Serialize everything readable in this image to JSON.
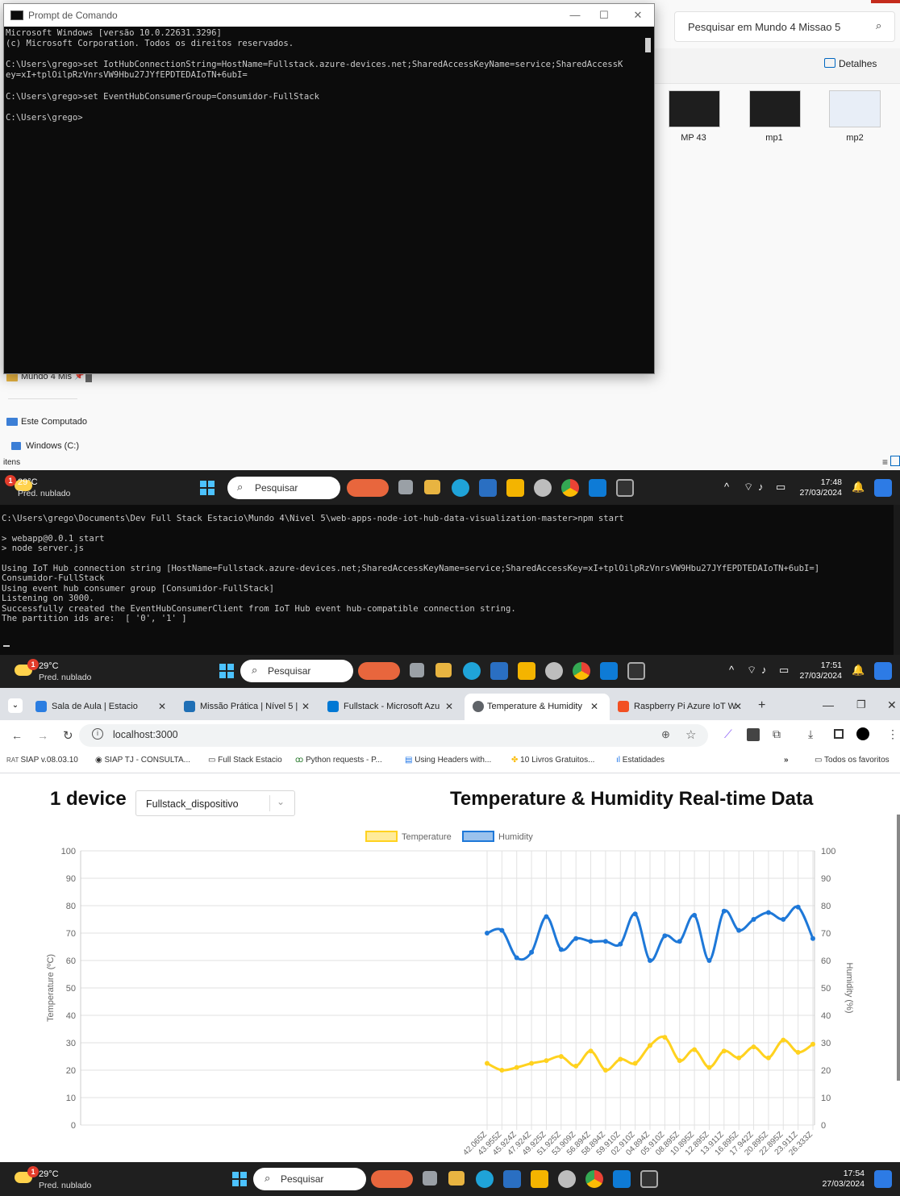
{
  "explorer": {
    "search_placeholder": "Pesquisar em Mundo 4 Missao 5",
    "details_label": "Detalhes",
    "thumbnails": [
      "MP 43",
      "mp1",
      "mp2"
    ],
    "sidebar": {
      "folder_item": "Mundo 4 Mis",
      "pc_item": "Este Computado",
      "drive_item": "Windows (C:)"
    },
    "status": "itens"
  },
  "cmd_window": {
    "title": "Prompt de Comando",
    "lines": [
      "Microsoft Windows [versão 10.0.22631.3296]",
      "(c) Microsoft Corporation. Todos os direitos reservados.",
      "",
      "C:\\Users\\grego>set IotHubConnectionString=HostName=Fullstack.azure-devices.net;SharedAccessKeyName=service;SharedAccessK",
      "ey=xI+tplOilpRzVnrsVW9Hbu27JYfEPDTEDAIoTN+6ubI=",
      "",
      "C:\\Users\\grego>set EventHubConsumerGroup=Consumidor-FullStack",
      "",
      "C:\\Users\\grego>"
    ]
  },
  "taskbar1": {
    "temp": "29°C",
    "condition": "Pred. nublado",
    "search": "Pesquisar",
    "time": "17:48",
    "date": "27/03/2024",
    "badge": "1"
  },
  "terminal2": {
    "lines": [
      "C:\\Users\\grego\\Documents\\Dev Full Stack Estacio\\Mundo 4\\Nivel 5\\web-apps-node-iot-hub-data-visualization-master>npm start",
      "",
      "> webapp@0.0.1 start",
      "> node server.js",
      "",
      "Using IoT Hub connection string [HostName=Fullstack.azure-devices.net;SharedAccessKeyName=service;SharedAccessKey=xI+tplOilpRzVnrsVW9Hbu27JYfEPDTEDAIoTN+6ubI=]",
      "Consumidor-FullStack",
      "Using event hub consumer group [Consumidor-FullStack]",
      "Listening on 3000.",
      "Successfully created the EventHubConsumerClient from IoT Hub event hub-compatible connection string.",
      "The partition ids are:  [ '0', '1' ]"
    ]
  },
  "taskbar2": {
    "temp": "29°C",
    "condition": "Pred. nublado",
    "search": "Pesquisar",
    "time": "17:51",
    "date": "27/03/2024",
    "badge": "1"
  },
  "taskbar3": {
    "temp": "29°C",
    "condition": "Pred. nublado",
    "search": "Pesquisar",
    "time": "17:54",
    "date": "27/03/2024",
    "badge": "1"
  },
  "browser": {
    "tabs": [
      {
        "label": "Sala de Aula | Estacio",
        "color": "#2a7de1"
      },
      {
        "label": "Missão Prática | Nível 5 |",
        "color": "#1f6fb5"
      },
      {
        "label": "Fullstack - Microsoft Azu",
        "color": "#0078d4"
      },
      {
        "label": "Temperature & Humidity",
        "color": "#5f6368"
      },
      {
        "label": "Raspberry Pi Azure IoT W",
        "color": "#f25022"
      }
    ],
    "url": "localhost:3000",
    "bookmarks": [
      "SIAP v.08.03.10",
      "SIAP TJ - CONSULTA...",
      "Full Stack Estacio",
      "Python requests - P...",
      "Using Headers with...",
      "10 Livros Gratuitos...",
      "Estatidades"
    ],
    "all_bookmarks": "Todos os favoritos"
  },
  "page": {
    "device_count": "1 device",
    "device_selected": "Fullstack_dispositivo",
    "title": "Temperature & Humidity Real-time Data"
  },
  "chart_data": {
    "type": "line",
    "legend": [
      "Temperature",
      "Humidity"
    ],
    "ylabel_left": "Temperature (ºC)",
    "ylabel_right": "Humidity (%)",
    "ylim": [
      0,
      100
    ],
    "y_ticks": [
      0,
      10,
      20,
      30,
      40,
      50,
      60,
      70,
      80,
      90,
      100
    ],
    "x": [
      "42.065Z",
      "43.955Z",
      "45.924Z",
      "47.924Z",
      "49.925Z",
      "51.925Z",
      "53.909Z",
      "56.894Z",
      "58.894Z",
      "59.910Z",
      "02.910Z",
      "04.894Z",
      "05.910Z",
      "08.895Z",
      "10.895Z",
      "12.895Z",
      "13.911Z",
      "16.895Z",
      "17.942Z",
      "20.895Z",
      "22.895Z",
      "23.911Z",
      "26.333Z"
    ],
    "series": [
      {
        "name": "Temperature",
        "color": "#ffd21f",
        "values": [
          22.5,
          20,
          21,
          22.5,
          23.5,
          25,
          21.5,
          27,
          20,
          24,
          22.5,
          29,
          32,
          23.5,
          27.5,
          21,
          27,
          24.5,
          28.5,
          24.5,
          31,
          26.5,
          29.5
        ]
      },
      {
        "name": "Humidity",
        "color": "#1e78d8",
        "values": [
          70,
          71,
          61,
          63,
          76,
          64,
          68,
          67,
          67,
          66,
          77,
          60,
          69,
          67,
          76.5,
          60,
          78,
          71,
          75,
          77.5,
          75,
          79.5,
          68
        ]
      }
    ]
  }
}
